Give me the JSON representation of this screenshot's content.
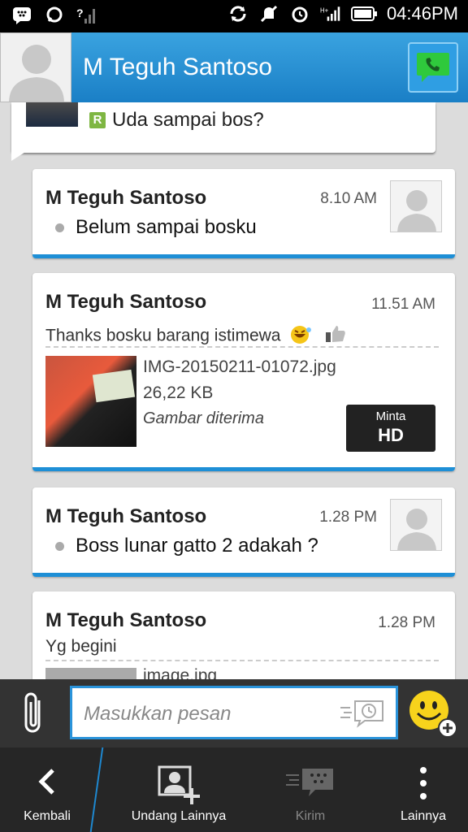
{
  "status_bar": {
    "time": "04:46PM"
  },
  "header": {
    "title": "M Teguh Santoso"
  },
  "messages": {
    "sent": {
      "text": "Uda sampai bos?"
    },
    "m1": {
      "sender": "M Teguh Santoso",
      "time": "8.10 AM",
      "text": "Belum sampai bosku"
    },
    "m2": {
      "sender": "M Teguh Santoso",
      "time": "11.51 AM",
      "text": "Thanks bosku barang istimewa",
      "file_name": "IMG-20150211-01072.jpg",
      "file_size": "26,22 KB",
      "file_status": "Gambar diterima",
      "hd_small": "Minta",
      "hd_big": "HD"
    },
    "m3": {
      "sender": "M Teguh Santoso",
      "time": "1.28 PM",
      "text": "Boss lunar gatto 2 adakah ?"
    },
    "m4": {
      "sender": "M Teguh Santoso",
      "time": "1.28 PM",
      "text": "Yg begini",
      "file_name_partial": "image.jpg"
    }
  },
  "input": {
    "placeholder": "Masukkan pesan"
  },
  "nav": {
    "back": "Kembali",
    "invite": "Undang Lainnya",
    "send": "Kirim",
    "more": "Lainnya"
  },
  "colors": {
    "accent": "#1e8fd6",
    "header": "#2a8fd4",
    "nav_bg": "#262626"
  }
}
